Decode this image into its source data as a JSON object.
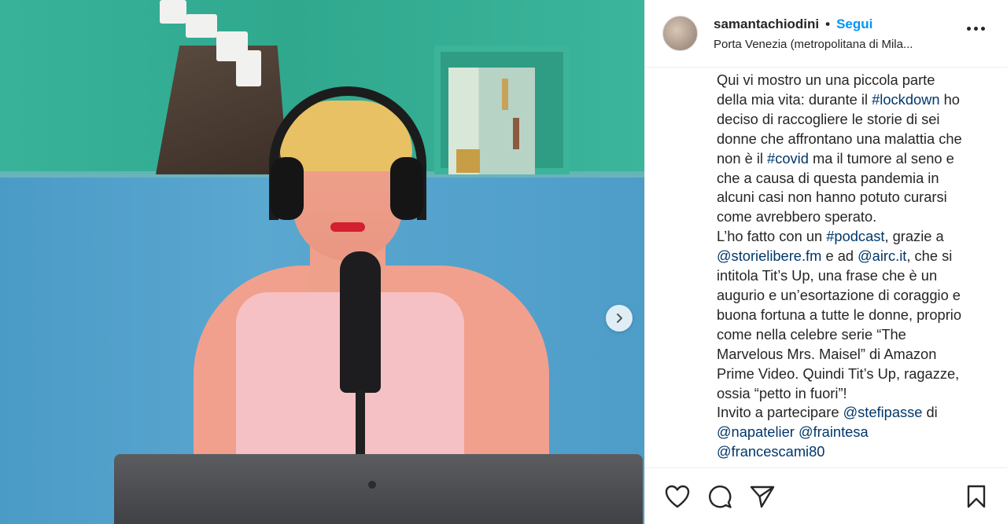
{
  "photo": {
    "next_button_icon": "chevron-right-icon"
  },
  "header": {
    "username": "samantachiodini",
    "separator": "•",
    "follow_label": "Segui",
    "location": "Porta Venezia (metropolitana di Mila...",
    "more_icon": "more-horizontal-icon"
  },
  "caption": {
    "segments": [
      {
        "t": "Qui vi mostro un una piccola parte\ndella mia vita: durante il "
      },
      {
        "t": "#lockdown",
        "tag": true
      },
      {
        "t": " ho\ndeciso di raccogliere le storie di sei\ndonne che affrontano una malattia che\nnon è il "
      },
      {
        "t": "#covid",
        "tag": true
      },
      {
        "t": " ma il tumore al seno e\nche a causa di questa pandemia in\nalcuni casi non hanno potuto curarsi\ncome avrebbero sperato.\nL’ho fatto con un "
      },
      {
        "t": "#podcast",
        "tag": true
      },
      {
        "t": ", grazie a\n"
      },
      {
        "t": "@storielibere.fm",
        "tag": true
      },
      {
        "t": " e ad "
      },
      {
        "t": "@airc.it",
        "tag": true
      },
      {
        "t": ", che si\nintitola Tit’s Up, una frase che è un\naugurio e un’esortazione di coraggio e\nbuona fortuna a tutte le donne, proprio\ncome nella celebre serie “The\nMarvelous Mrs. Maisel” di Amazon\nPrime Video. Quindi Tit’s Up, ragazze,\nossia “petto in fuori”!\nInvito a partecipare "
      },
      {
        "t": "@stefipasse",
        "tag": true
      },
      {
        "t": " di\n"
      },
      {
        "t": "@napatelier",
        "tag": true
      },
      {
        "t": " "
      },
      {
        "t": "@fraintesa",
        "tag": true
      },
      {
        "t": "\n"
      },
      {
        "t": "@francescami80",
        "tag": true
      }
    ]
  },
  "actions": {
    "icons": [
      "heart-icon",
      "comment-icon",
      "share-icon",
      "bookmark-icon"
    ]
  },
  "colors": {
    "link": "#00376b",
    "follow": "#0095f6",
    "text": "#262626"
  }
}
